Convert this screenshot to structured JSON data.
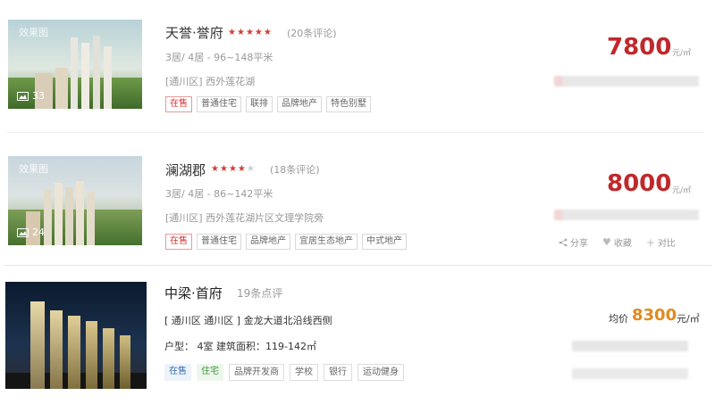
{
  "listings": [
    {
      "title": "天誉·誉府",
      "rating": 4.5,
      "reviews": "(20条评论)",
      "spec": "3居/ 4居  -  96~148平米",
      "address": "[通川区] 西外莲花湖",
      "status_tag": "在售",
      "tags": [
        "普通住宅",
        "联排",
        "品牌地产",
        "特色别墅"
      ],
      "price": "7800",
      "price_unit": "元/㎡",
      "image_watermark": "效果图",
      "photo_count": "33"
    },
    {
      "title": "澜湖郡",
      "rating": 3.5,
      "reviews": "(18条评论)",
      "spec": "3居/ 4居  -  86~142平米",
      "address": "[通川区] 西外莲花湖片区文理学院旁",
      "status_tag": "在售",
      "tags": [
        "普通住宅",
        "品牌地产",
        "宜居生态地产",
        "中式地产"
      ],
      "price": "8000",
      "price_unit": "元/㎡",
      "image_watermark": "效果图",
      "photo_count": "24",
      "actions": {
        "share": "分享",
        "favorite": "收藏",
        "compare": "对比"
      }
    },
    {
      "title": "中梁·首府",
      "reviews": "19条点评",
      "address": "[ 通川区 通川区 ] 金龙大道北沿线西侧",
      "spec": "户型： 4室   建筑面积：119-142㎡",
      "tags_colored": [
        {
          "label": "在售",
          "style": "blue"
        },
        {
          "label": "住宅",
          "style": "green"
        }
      ],
      "tags": [
        "品牌开发商",
        "学校",
        "银行",
        "运动健身"
      ],
      "price_label": "均价",
      "price": "8300",
      "price_unit": "元/㎡"
    }
  ],
  "colors": {
    "price_red": "#c0282c",
    "star_red": "#d23c36",
    "avg_orange": "#e08a1e"
  }
}
